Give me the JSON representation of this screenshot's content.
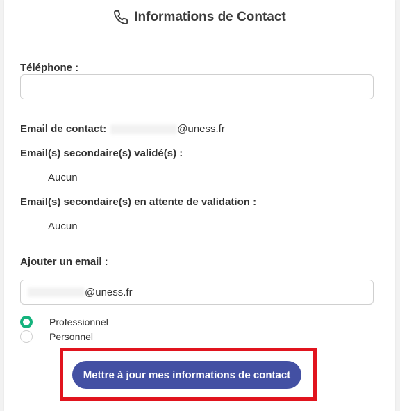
{
  "header": {
    "title": "Informations de Contact",
    "icon": "phone-icon"
  },
  "form": {
    "phone_label": "Téléphone :",
    "phone_value": "",
    "contact_email_label": "Email de contact:",
    "contact_email_visible": "@uness.fr",
    "secondary_validated_label": "Email(s) secondaire(s) validé(s) :",
    "secondary_validated_value": "Aucun",
    "secondary_pending_label": "Email(s) secondaire(s) en attente de validation :",
    "secondary_pending_value": "Aucun",
    "add_email_label": "Ajouter un email :",
    "add_email_visible": "@uness.fr",
    "email_types": [
      {
        "label": "Professionnel",
        "checked": true
      },
      {
        "label": "Personnel",
        "checked": false
      }
    ],
    "submit_label": "Mettre à jour mes informations de contact"
  },
  "colors": {
    "accent": "#4350a3",
    "radio_checked": "#14b37d",
    "highlight_border": "#e1141e"
  }
}
